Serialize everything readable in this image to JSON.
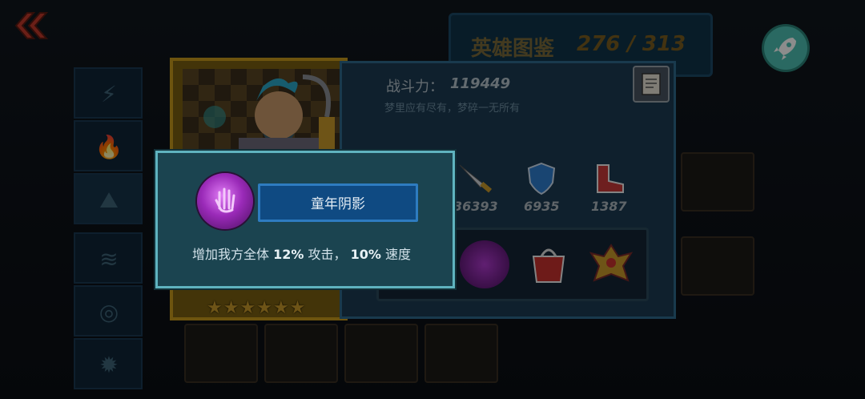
{
  "header": {
    "back_icon": "double-chevron-left-icon",
    "catalog_title": "英雄图鉴",
    "catalog_count": "276 / 313",
    "rocket_icon": "rocket-icon"
  },
  "sidebar": {
    "tabs": [
      {
        "icon": "lightning-icon",
        "glyph": "⚡"
      },
      {
        "icon": "fire-icon",
        "glyph": "🔥"
      },
      {
        "icon": "earth-icon",
        "glyph": "⛰"
      },
      {
        "icon": "water-icon",
        "glyph": "≋"
      },
      {
        "icon": "wind-icon",
        "glyph": "◎"
      },
      {
        "icon": "sun-icon",
        "glyph": "✹"
      }
    ]
  },
  "hero": {
    "star_count": 6,
    "power_label": "战斗力：",
    "power_value": "119449",
    "motto": "梦里应有尽有，梦碎一无所有",
    "stats": [
      {
        "icon": "sword-icon",
        "value": "36393"
      },
      {
        "icon": "shield-icon",
        "value": "6935"
      },
      {
        "icon": "boot-icon",
        "value": "1387"
      }
    ],
    "equipment": [
      {
        "icon": "purple-orb-icon"
      },
      {
        "icon": "red-bag-icon"
      },
      {
        "icon": "gold-emblem-icon"
      }
    ]
  },
  "popup": {
    "skill_icon": "purple-orb-icon",
    "skill_name": "童年阴影",
    "desc_prefix": "增加我方全体 ",
    "desc_atk_pct": "12%",
    "desc_mid": " 攻击， ",
    "desc_spd_pct": "10%",
    "desc_suffix": " 速度"
  },
  "colors": {
    "popup_border": "#5fb3bf",
    "popup_bg": "#1b4450",
    "name_box": "#0f4a82",
    "gold_frame": "#c79a1d"
  }
}
